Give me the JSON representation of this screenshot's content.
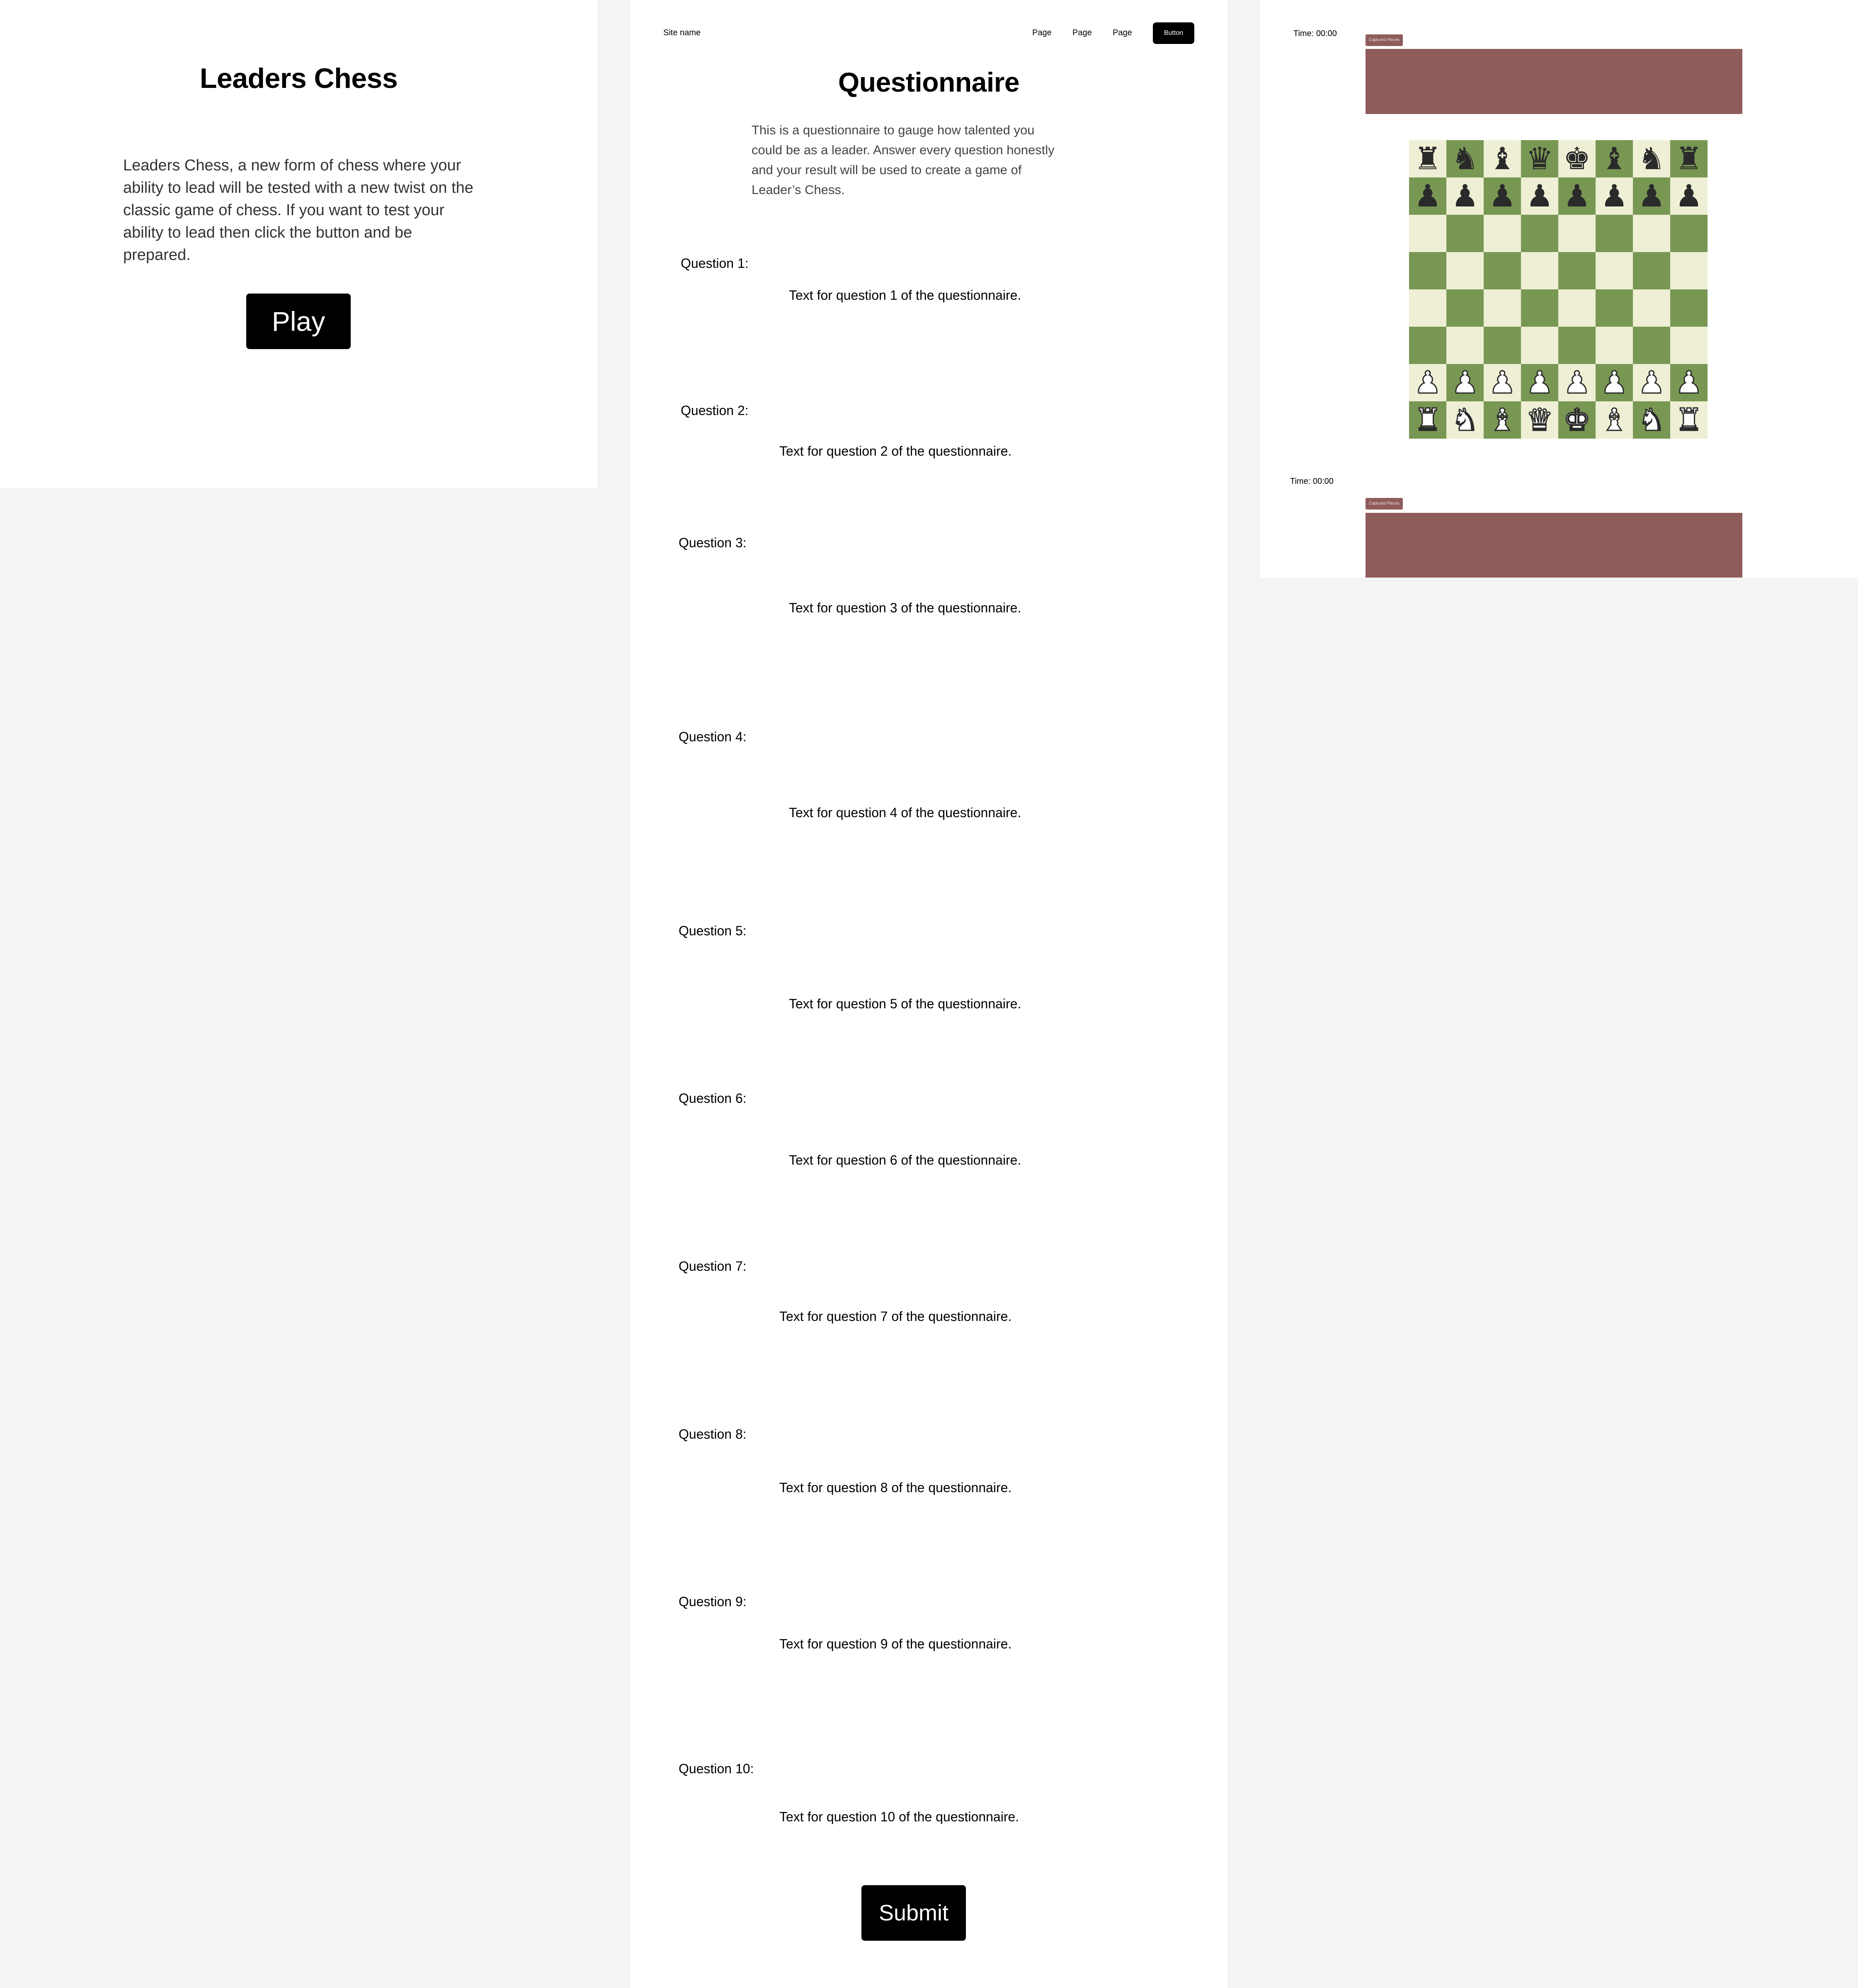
{
  "landing": {
    "title": "Leaders Chess",
    "description": "Leaders Chess, a new form of chess where your ability to lead will be tested with a new twist on the classic game of chess. If you want to test your ability to lead then click the button and be prepared.",
    "play_label": "Play"
  },
  "questionnaire": {
    "site_name": "Site name",
    "nav": [
      "Page",
      "Page",
      "Page"
    ],
    "nav_button": "Button",
    "title": "Questionnaire",
    "description": "This is a questionnaire to gauge how talented you could be as a leader. Answer every question honestly and your result will be used to create a game of Leader’s Chess.",
    "questions": [
      {
        "label": "Question 1:",
        "text": "Text for question 1 of the questionnaire."
      },
      {
        "label": "Question 2:",
        "text": "Text for question 2 of the questionnaire."
      },
      {
        "label": "Question 3:",
        "text": "Text for question 3 of the questionnaire."
      },
      {
        "label": "Question 4:",
        "text": "Text for question 4 of the questionnaire."
      },
      {
        "label": "Question 5:",
        "text": "Text for question 5 of the questionnaire."
      },
      {
        "label": "Question 6:",
        "text": "Text for question 6 of the questionnaire."
      },
      {
        "label": "Question 7:",
        "text": "Text for question 7 of the questionnaire."
      },
      {
        "label": "Question 8:",
        "text": "Text for question 8 of the questionnaire."
      },
      {
        "label": "Question 9:",
        "text": "Text for question 9 of the questionnaire."
      },
      {
        "label": "Question 10:",
        "text": "Text for question 10 of the questionnaire."
      }
    ],
    "submit_label": "Submit"
  },
  "game": {
    "top_player": {
      "time": "Time: 00:00",
      "captured_label": "Captured Pieces"
    },
    "bottom_player": {
      "time": "Time: 00:00",
      "captured_label": "Captured Pieces"
    },
    "colors": {
      "light_square": "#eeefd4",
      "dark_square": "#789753",
      "captured_area": "#8e5c5b"
    },
    "board": [
      [
        "r",
        "n",
        "b",
        "q",
        "k",
        "b",
        "n",
        "r"
      ],
      [
        "p",
        "p",
        "p",
        "p",
        "p",
        "p",
        "p",
        "p"
      ],
      [
        "",
        "",
        "",
        "",
        "",
        "",
        "",
        ""
      ],
      [
        "",
        "",
        "",
        "",
        "",
        "",
        "",
        ""
      ],
      [
        "",
        "",
        "",
        "",
        "",
        "",
        "",
        ""
      ],
      [
        "",
        "",
        "",
        "",
        "",
        "",
        "",
        ""
      ],
      [
        "P",
        "P",
        "P",
        "P",
        "P",
        "P",
        "P",
        "P"
      ],
      [
        "R",
        "N",
        "B",
        "Q",
        "K",
        "B",
        "N",
        "R"
      ]
    ]
  }
}
